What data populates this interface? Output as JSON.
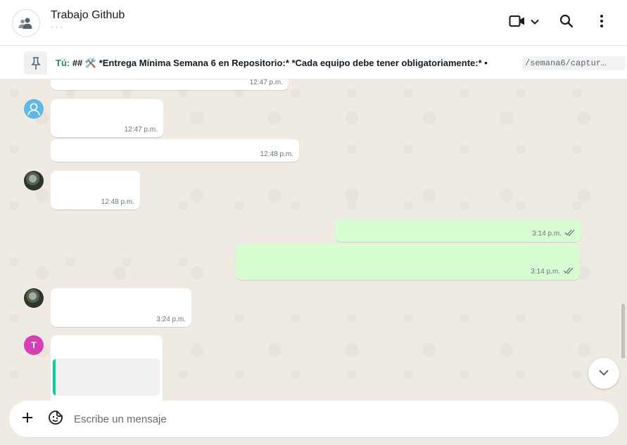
{
  "header": {
    "title": "Trabajo Github",
    "subtitle": "· · ·",
    "icons": [
      "group-avatar-icon",
      "video-call-icon",
      "chevron-down-icon",
      "search-icon",
      "menu-icon"
    ]
  },
  "pinned": {
    "sender": "Tú:",
    "text": " ## 🛠️ *Entrega Mínima Semana 6 en Repositorio:* *Cada equipo debe tener obligatoriamente:* •",
    "code": "/semana6/captur…"
  },
  "messages": [
    {
      "time": "12:47 p.m.",
      "direction": "in"
    },
    {
      "time": "12:47 p.m.",
      "direction": "in"
    },
    {
      "time": "12:48 p.m.",
      "direction": "in"
    },
    {
      "time": "12:48 p.m.",
      "direction": "in"
    },
    {
      "time": "3:14 p.m.",
      "direction": "out"
    },
    {
      "time": "3:14 p.m.",
      "direction": "out"
    },
    {
      "time": "3:24 p.m.",
      "direction": "in"
    },
    {
      "time": "",
      "direction": "in",
      "avatar_letter": "T"
    }
  ],
  "composer": {
    "placeholder": "Escribe un mensaje"
  },
  "colors": {
    "incoming_bubble": "#ffffff",
    "outgoing_bubble": "#d9fdd3",
    "pinned_sender": "#1d9157",
    "quote_accent": "#06cf9c",
    "avatar_t": "#d63eb4"
  }
}
